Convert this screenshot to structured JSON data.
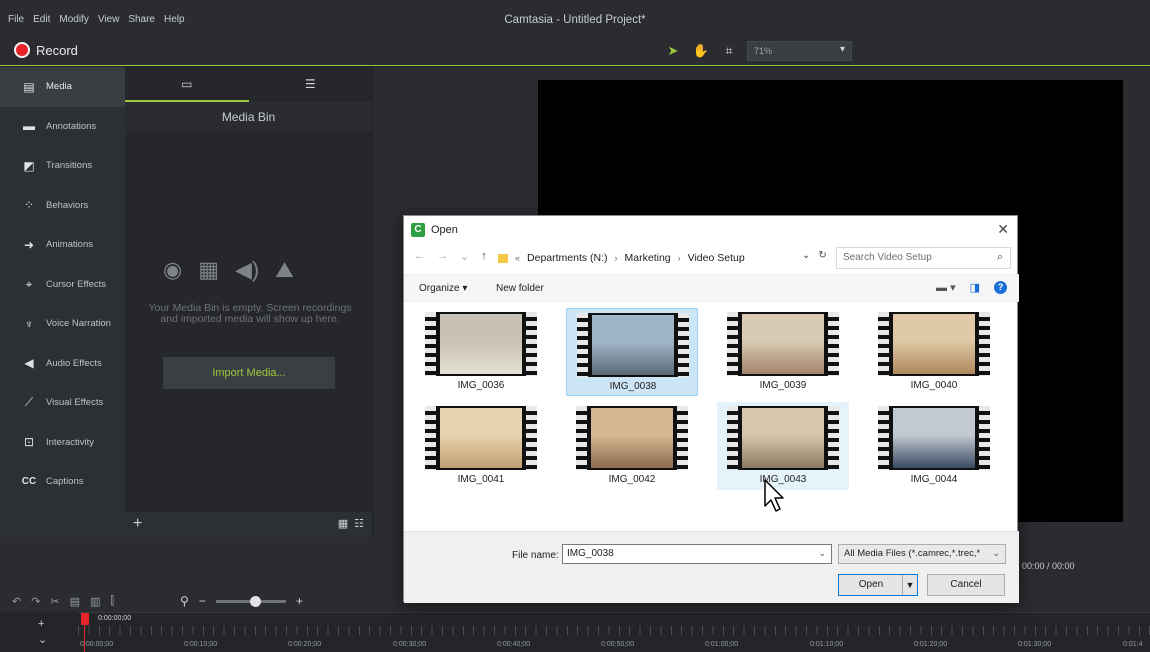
{
  "app": {
    "title": "Camtasia - Untitled Project*",
    "menu": [
      "File",
      "Edit",
      "Modify",
      "View",
      "Share",
      "Help"
    ],
    "record_label": "Record",
    "zoom": "71%"
  },
  "sidebar": {
    "items": [
      {
        "label": "Media",
        "icon": "film-strip-icon",
        "glyph": "▤"
      },
      {
        "label": "Annotations",
        "icon": "annotation-icon",
        "glyph": "▬"
      },
      {
        "label": "Transitions",
        "icon": "transition-icon",
        "glyph": "◩"
      },
      {
        "label": "Behaviors",
        "icon": "behaviors-icon",
        "glyph": "⁘"
      },
      {
        "label": "Animations",
        "icon": "animation-arrow-icon",
        "glyph": "➜"
      },
      {
        "label": "Cursor Effects",
        "icon": "cursor-effects-icon",
        "glyph": "⌖"
      },
      {
        "label": "Voice Narration",
        "icon": "microphone-icon",
        "glyph": "🎤"
      },
      {
        "label": "Audio Effects",
        "icon": "speaker-icon",
        "glyph": "◀)"
      },
      {
        "label": "Visual Effects",
        "icon": "magic-wand-icon",
        "glyph": "⟋"
      },
      {
        "label": "Interactivity",
        "icon": "interactivity-icon",
        "glyph": "⊡"
      },
      {
        "label": "Captions",
        "icon": "captions-icon",
        "glyph": "CC"
      }
    ]
  },
  "media_bin": {
    "title": "Media Bin",
    "empty_text": "Your Media Bin is empty. Screen recordings and imported media will show up here.",
    "import_label": "Import Media..."
  },
  "playback": {
    "timecode": "00:00 / 00:00"
  },
  "timeline": {
    "playhead_time": "0:00:00;00",
    "labels": [
      "0:00:00;00",
      "0:00:10;00",
      "0:00:20;00",
      "0:00:30;00",
      "0:00:40;00",
      "0:00:50;00",
      "0:01:00;00",
      "0:01:10;00",
      "0:01:20;00",
      "0:01:30;00",
      "0:01:4"
    ]
  },
  "dialog": {
    "title": "Open",
    "breadcrumb": [
      "Departments (N:)",
      "Marketing",
      "Video Setup"
    ],
    "search_placeholder": "Search Video Setup",
    "organize_label": "Organize ▾",
    "new_folder_label": "New folder",
    "files": [
      {
        "name": "IMG_0036",
        "tone": [
          "#c9c2b4",
          "#e6e1d6"
        ]
      },
      {
        "name": "IMG_0038",
        "tone": [
          "#9fb5c7",
          "#5a6a78"
        ],
        "selected": true
      },
      {
        "name": "IMG_0039",
        "tone": [
          "#d9cbb3",
          "#a1846a"
        ]
      },
      {
        "name": "IMG_0040",
        "tone": [
          "#e0c9a6",
          "#b0885e"
        ]
      },
      {
        "name": "IMG_0041",
        "tone": [
          "#e6d2b0",
          "#c29e70"
        ]
      },
      {
        "name": "IMG_0042",
        "tone": [
          "#d8b894",
          "#8c6a4e"
        ]
      },
      {
        "name": "IMG_0043",
        "tone": [
          "#d6c6ad",
          "#8d7a63"
        ],
        "hover": true
      },
      {
        "name": "IMG_0044",
        "tone": [
          "#c2c9d0",
          "#3a4a63"
        ]
      }
    ],
    "file_name_label": "File name:",
    "file_name_value": "IMG_0038",
    "filter_value": "All Media Files (*.camrec,*.trec,*",
    "open_label": "Open",
    "cancel_label": "Cancel"
  }
}
